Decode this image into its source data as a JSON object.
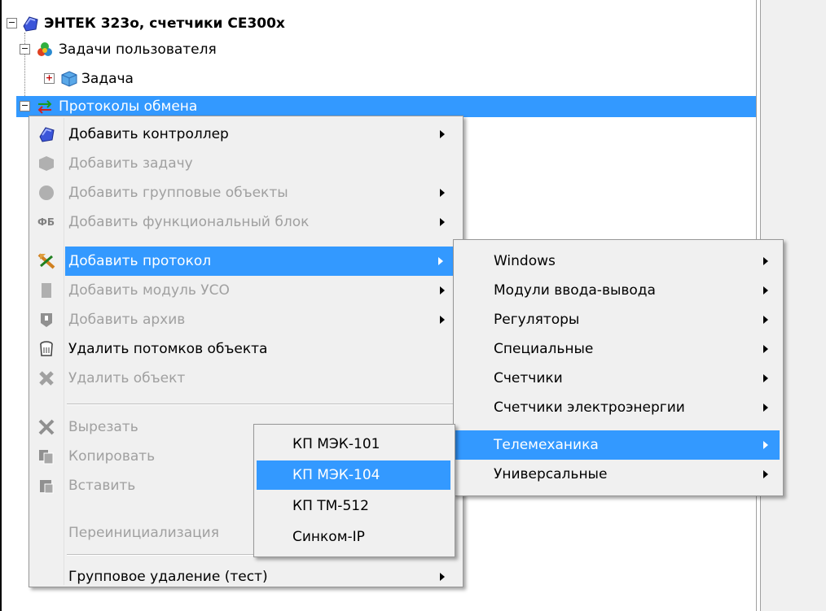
{
  "tree": {
    "root": {
      "label": "ЭНТЕК 323о, счетчики СЕ300х",
      "expander": "−"
    },
    "user_tasks": {
      "label": "Задачи пользователя",
      "expander": "−"
    },
    "task": {
      "label": "Задача",
      "expander": "+"
    },
    "protocols": {
      "label": "Протоколы обмена",
      "expander": "−"
    }
  },
  "context_menu": {
    "items": [
      {
        "label": "Добавить контроллер"
      },
      {
        "label": "Добавить задачу"
      },
      {
        "label": "Добавить групповые объекты"
      },
      {
        "label": "Добавить функциональный блок",
        "icon_text": "ФБ"
      },
      {
        "label": "Добавить протокол"
      },
      {
        "label": "Добавить модуль УСО"
      },
      {
        "label": "Добавить архив"
      },
      {
        "label": "Удалить потомков объекта"
      },
      {
        "label": "Удалить объект"
      },
      {
        "label": "Вырезать"
      },
      {
        "label": "Копировать"
      },
      {
        "label": "Вставить"
      },
      {
        "label": "Переинициализация"
      },
      {
        "label": "Групповое удаление (тест)"
      }
    ]
  },
  "protocol_submenu": {
    "items": [
      {
        "label": "Windows"
      },
      {
        "label": "Модули ввода-вывода"
      },
      {
        "label": "Регуляторы"
      },
      {
        "label": "Специальные"
      },
      {
        "label": "Счетчики"
      },
      {
        "label": "Счетчики электроэнергии"
      },
      {
        "label": "Телемеханика"
      },
      {
        "label": "Универсальные"
      }
    ]
  },
  "telemechanics_submenu": {
    "items": [
      {
        "label": "КП МЭК-101"
      },
      {
        "label": "КП МЭК-104"
      },
      {
        "label": "КП ТМ-512"
      },
      {
        "label": "Синком-IP"
      }
    ]
  },
  "colors": {
    "highlight": "#3399ff",
    "menu_bg": "#f0f0f0",
    "disabled_text": "#a0a0a0"
  }
}
